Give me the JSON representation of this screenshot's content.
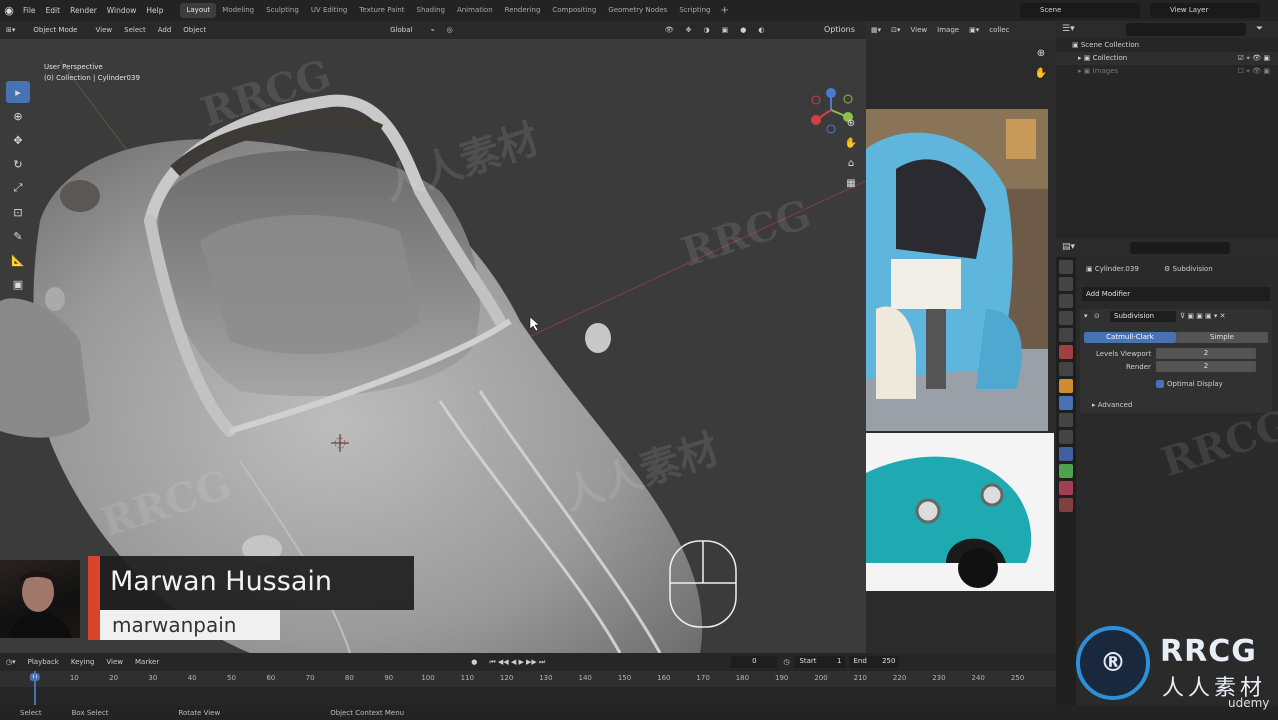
{
  "topbar": {
    "menus": [
      "File",
      "Edit",
      "Render",
      "Window",
      "Help"
    ],
    "workspaces": [
      "Layout",
      "Modeling",
      "Sculpting",
      "UV Editing",
      "Texture Paint",
      "Shading",
      "Animation",
      "Rendering",
      "Compositing",
      "Geometry Nodes",
      "Scripting"
    ],
    "active_workspace": "Layout",
    "scene": "Scene",
    "view_layer": "View Layer"
  },
  "viewport": {
    "mode": "Object Mode",
    "menus": [
      "View",
      "Select",
      "Add",
      "Object"
    ],
    "transform_orientation": "Global",
    "options_label": "Options",
    "perspective_label": "User Perspective",
    "collection_label": "(0) Collection | Cylinder039"
  },
  "reference_panel": {
    "menus": [
      "View",
      "Image"
    ],
    "image_name": "collec"
  },
  "outliner": {
    "rows": [
      "Scene Collection",
      "Collection",
      "Images"
    ]
  },
  "properties": {
    "object_name": "Cylinder.039",
    "modifier_context": "Subdivision",
    "add_modifier_label": "Add Modifier",
    "modifier_name": "Subdivision",
    "catmull_clark_label": "Catmull-Clark",
    "simple_label": "Simple",
    "levels_viewport_label": "Levels Viewport",
    "levels_viewport_value": "2",
    "render_label": "Render",
    "render_value": "2",
    "optimal_display_label": "Optimal Display",
    "advanced_label": "Advanced"
  },
  "timeline": {
    "menus": [
      "Playback",
      "Keying",
      "View",
      "Marker"
    ],
    "current_frame": "0",
    "start_label": "Start",
    "start_value": "1",
    "end_label": "End",
    "end_value": "250",
    "ruler_ticks": [
      "0",
      "10",
      "20",
      "30",
      "40",
      "50",
      "60",
      "70",
      "80",
      "90",
      "100",
      "110",
      "120",
      "130",
      "140",
      "150",
      "160",
      "170",
      "180",
      "190",
      "200",
      "210",
      "220",
      "230",
      "240",
      "250"
    ],
    "cursor_frame": "0"
  },
  "statusbar": {
    "items": [
      "Select",
      "Box Select",
      "Rotate View",
      "Object Context Menu"
    ]
  },
  "presenter": {
    "name": "Marwan Hussain",
    "handle": "marwanpain"
  },
  "branding": {
    "udemy": "udemy",
    "rrcg": "RRCG",
    "rrcg_cn": "人人素材",
    "accent_color": "#4772b3",
    "lower_third_accent": "#d9442c"
  }
}
